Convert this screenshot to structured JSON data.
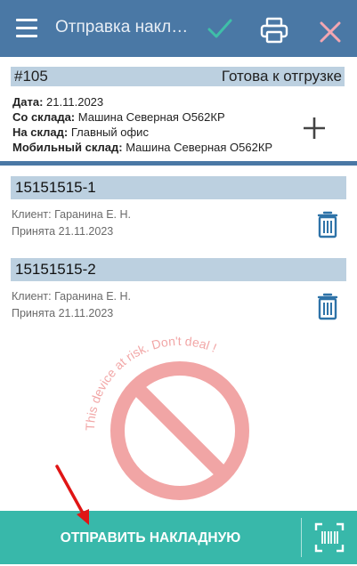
{
  "appbar": {
    "title": "Отправка накладной",
    "bg_color": "#4a78a5",
    "icons": [
      "menu-icon",
      "check-icon",
      "printer-icon",
      "close-icon"
    ]
  },
  "document": {
    "number": "#105",
    "status": "Готова к отгрузке",
    "fields": [
      {
        "label": "Дата:",
        "value": "21.11.2023"
      },
      {
        "label": "Со склада:",
        "value": "Машина Северная О562КР"
      },
      {
        "label": "На склад:",
        "value": "Главный офис"
      },
      {
        "label": "Мобильный склад:",
        "value": "Машина Северная О562КР"
      }
    ]
  },
  "items": [
    {
      "code": "15151515-1",
      "client": "Клиент: Гаранина Е. Н.",
      "accepted": "Принята 21.11.2023"
    },
    {
      "code": "15151515-2",
      "client": "Клиент: Гаранина Е. Н.",
      "accepted": "Принята 21.11.2023"
    }
  ],
  "watermark": {
    "text": "This device at risk. Don't deal !",
    "color": "#e23a3a"
  },
  "bottom": {
    "send_label": "ОТПРАВИТЬ НАКЛАДНУЮ",
    "bg_color": "#38b8aa",
    "scan_icon": "barcode-scan-icon"
  }
}
